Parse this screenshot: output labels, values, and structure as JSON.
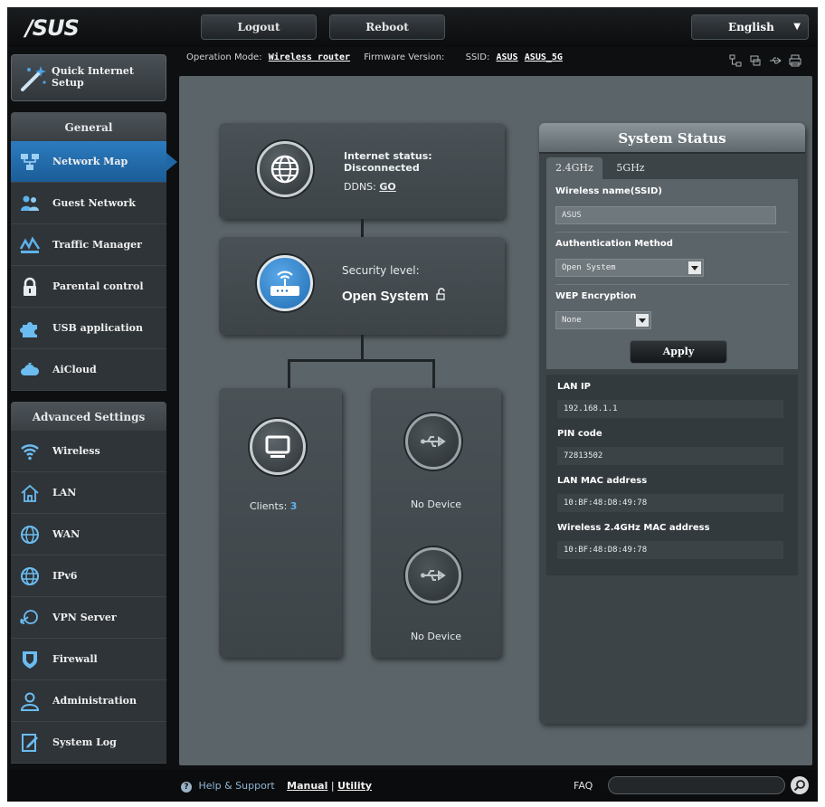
{
  "header": {
    "logo": "/SUS",
    "logout_label": "Logout",
    "reboot_label": "Reboot",
    "language": "English"
  },
  "info": {
    "operation_mode_label": "Operation Mode:",
    "operation_mode_value": "Wireless router",
    "firmware_label": "Firmware Version:",
    "ssid_label": "SSID:",
    "ssid_1": "ASUS",
    "ssid_2": "ASUS_5G"
  },
  "sidebar": {
    "qis_label": "Quick Internet Setup",
    "general_header": "General",
    "general_items": [
      {
        "label": "Network Map",
        "icon": "network-map-icon"
      },
      {
        "label": "Guest Network",
        "icon": "guest-network-icon"
      },
      {
        "label": "Traffic Manager",
        "icon": "traffic-manager-icon"
      },
      {
        "label": "Parental control",
        "icon": "lock-icon"
      },
      {
        "label": "USB application",
        "icon": "puzzle-icon"
      },
      {
        "label": "AiCloud",
        "icon": "cloud-icon"
      }
    ],
    "advanced_header": "Advanced Settings",
    "advanced_items": [
      {
        "label": "Wireless",
        "icon": "wifi-icon"
      },
      {
        "label": "LAN",
        "icon": "home-icon"
      },
      {
        "label": "WAN",
        "icon": "globe-icon"
      },
      {
        "label": "IPv6",
        "icon": "ipv6-globe-icon"
      },
      {
        "label": "VPN Server",
        "icon": "vpn-icon"
      },
      {
        "label": "Firewall",
        "icon": "shield-icon"
      },
      {
        "label": "Administration",
        "icon": "user-icon"
      },
      {
        "label": "System Log",
        "icon": "log-icon"
      }
    ]
  },
  "network_map": {
    "internet_status_label": "Internet status:",
    "internet_status_value": "Disconnected",
    "ddns_label": "DDNS:",
    "ddns_link": "GO",
    "security_label": "Security level:",
    "security_value": "Open System",
    "clients_label": "Clients:",
    "clients_count": "3",
    "usb1_label": "No Device",
    "usb2_label": "No Device"
  },
  "system_status": {
    "title": "System Status",
    "tabs": [
      "2.4GHz",
      "5GHz"
    ],
    "ssid_label": "Wireless name(SSID)",
    "ssid_value": "ASUS",
    "auth_label": "Authentication Method",
    "auth_value": "Open System",
    "wep_label": "WEP Encryption",
    "wep_value": "None",
    "apply_label": "Apply",
    "lan_ip_label": "LAN IP",
    "lan_ip_value": "192.168.1.1",
    "pin_label": "PIN code",
    "pin_value": "72813502",
    "lan_mac_label": "LAN MAC address",
    "lan_mac_value": "10:BF:48:D8:49:78",
    "wl_mac_label": "Wireless 2.4GHz MAC address",
    "wl_mac_value": "10:BF:48:D8:49:78"
  },
  "footer": {
    "help_label": "Help & Support",
    "manual_label": "Manual",
    "separator": "|",
    "utility_label": "Utility",
    "faq_label": "FAQ"
  }
}
